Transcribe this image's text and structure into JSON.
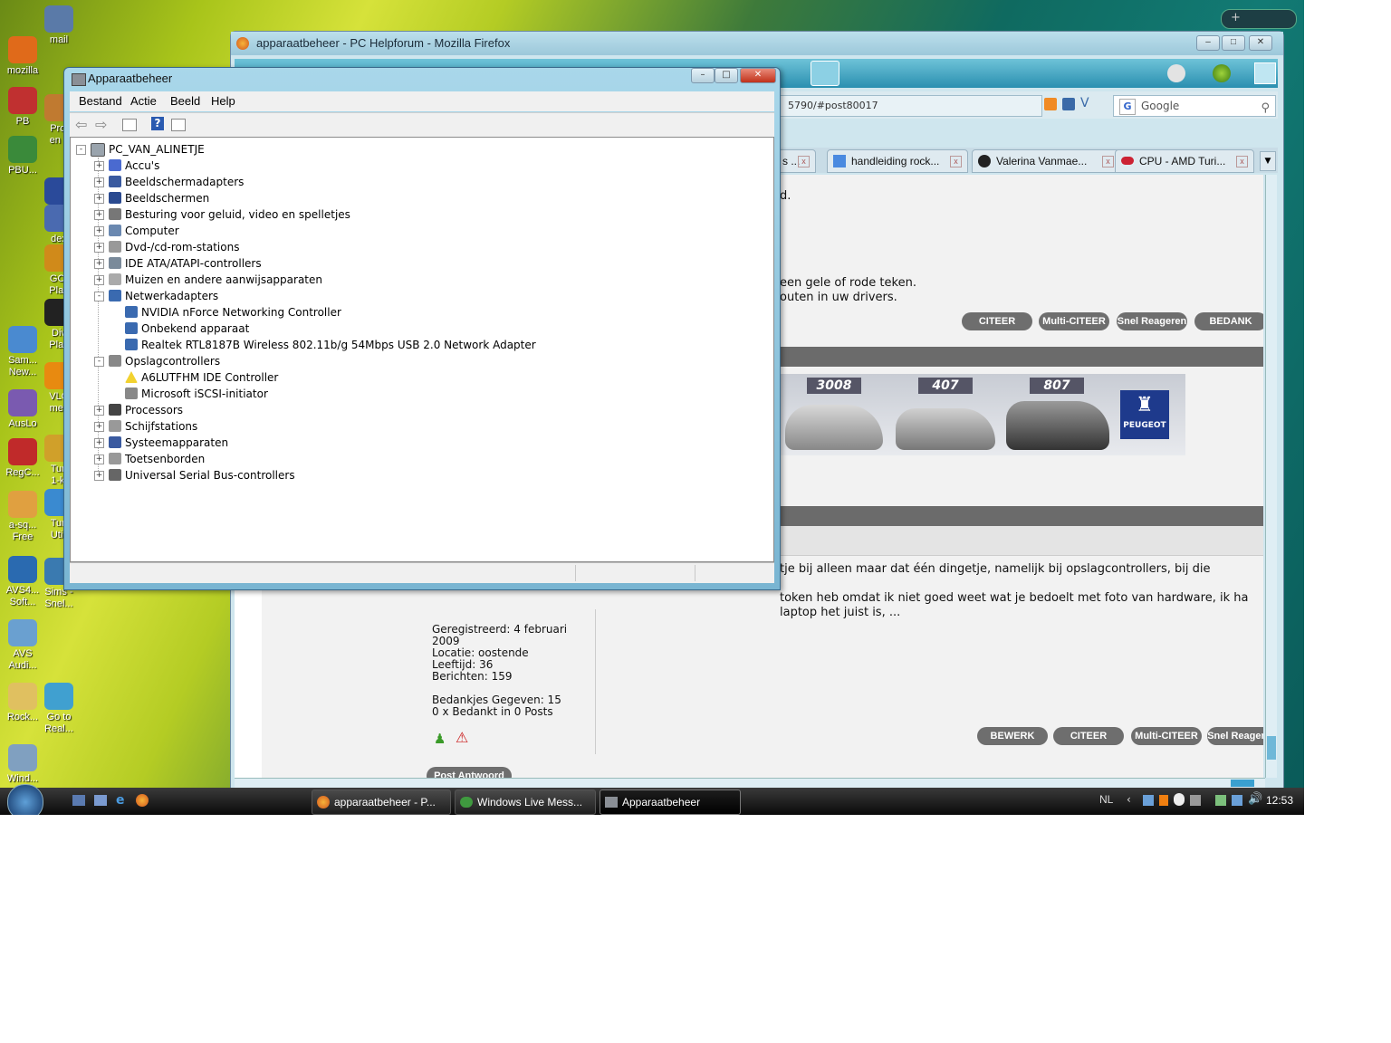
{
  "desktop": {
    "icons": [
      {
        "label": "mail"
      },
      {
        "label": "mozilla"
      },
      {
        "label": "PB"
      },
      {
        "label": "Prol\nen c"
      },
      {
        "label": "PBU..."
      },
      {
        "label": "bev"
      },
      {
        "label": "dex"
      },
      {
        "label": "GOI\nPlay"
      },
      {
        "label": "Div\nPlay"
      },
      {
        "label": "Sam...\nNew..."
      },
      {
        "label": "VLC\nmec"
      },
      {
        "label": "AusLo"
      },
      {
        "label": "RegC..."
      },
      {
        "label": "Tun\n1-kl"
      },
      {
        "label": "a-sq...\nFree"
      },
      {
        "label": "Tun\nUtili"
      },
      {
        "label": "AVS4...\nSoft..."
      },
      {
        "label": "Sims -\nSnel..."
      },
      {
        "label": "AVS\nAudi..."
      },
      {
        "label": "Rock..."
      },
      {
        "label": "Go to\nReal..."
      },
      {
        "label": "Wind..."
      }
    ]
  },
  "firefox": {
    "title": "apparaatbeheer - PC Helpforum - Mozilla Firefox",
    "url_fragment": "5790/#post80017",
    "search_placeholder": "Google",
    "tabs": [
      {
        "label": "s ..."
      },
      {
        "label": "handleiding rock..."
      },
      {
        "label": "Valerina Vanmae..."
      },
      {
        "label": "CPU - AMD Turi..."
      }
    ],
    "post1": {
      "line1": "d.",
      "line2": "een gele of rode teken.",
      "line3": "outen in uw drivers.",
      "buttons": [
        "CITEER",
        "Multi-CITEER",
        "Snel Reageren",
        "BEDANK"
      ]
    },
    "ad": {
      "models": [
        "3008",
        "407",
        "807"
      ],
      "brand": "PEUGEOT"
    },
    "post2": {
      "line1": "tje bij alleen maar dat één dingetje, namelijk bij opslagcontrollers, bij die",
      "line2": "token heb omdat ik niet goed weet wat je bedoelt met foto van hardware, ik ha",
      "line3": "laptop het juist is, ...",
      "profile": [
        "Geregistreerd: 4 februari",
        "2009",
        "Locatie: oostende",
        "Leeftijd: 36",
        "Berichten: 159",
        "",
        "Bedankjes Gegeven: 15",
        "0 x Bedankt in 0 Posts"
      ],
      "buttons": [
        "BEWERK",
        "CITEER",
        "Multi-CITEER",
        "Snel Reager"
      ]
    },
    "post_answer": "Post Antwoord"
  },
  "devmgr": {
    "title": "Apparaatbeheer",
    "menu": [
      "Bestand",
      "Actie",
      "Beeld",
      "Help"
    ],
    "root": "PC_VAN_ALINETJE",
    "nodes": [
      {
        "label": "Accu's",
        "level": 1,
        "expander": "+"
      },
      {
        "label": "Beeldschermadapters",
        "level": 1,
        "expander": "+"
      },
      {
        "label": "Beeldschermen",
        "level": 1,
        "expander": "+"
      },
      {
        "label": "Besturing voor geluid, video en spelletjes",
        "level": 1,
        "expander": "+"
      },
      {
        "label": "Computer",
        "level": 1,
        "expander": "+"
      },
      {
        "label": "Dvd-/cd-rom-stations",
        "level": 1,
        "expander": "+"
      },
      {
        "label": "IDE ATA/ATAPI-controllers",
        "level": 1,
        "expander": "+"
      },
      {
        "label": "Muizen en andere aanwijsapparaten",
        "level": 1,
        "expander": "+"
      },
      {
        "label": "Netwerkadapters",
        "level": 1,
        "expander": "-"
      },
      {
        "label": "NVIDIA nForce Networking Controller",
        "level": 2,
        "expander": ""
      },
      {
        "label": "Onbekend apparaat",
        "level": 2,
        "expander": ""
      },
      {
        "label": "Realtek RTL8187B Wireless 802.11b/g 54Mbps USB 2.0 Network Adapter",
        "level": 2,
        "expander": ""
      },
      {
        "label": "Opslagcontrollers",
        "level": 1,
        "expander": "-"
      },
      {
        "label": "A6LUTFHM IDE Controller",
        "level": 2,
        "expander": "",
        "warning": true
      },
      {
        "label": "Microsoft iSCSI-initiator",
        "level": 2,
        "expander": ""
      },
      {
        "label": "Processors",
        "level": 1,
        "expander": "+"
      },
      {
        "label": "Schijfstations",
        "level": 1,
        "expander": "+"
      },
      {
        "label": "Systeemapparaten",
        "level": 1,
        "expander": "+"
      },
      {
        "label": "Toetsenborden",
        "level": 1,
        "expander": "+"
      },
      {
        "label": "Universal Serial Bus-controllers",
        "level": 1,
        "expander": "+"
      }
    ]
  },
  "taskbar": {
    "buttons": [
      {
        "label": "apparaatbeheer - P..."
      },
      {
        "label": "Windows Live Mess..."
      },
      {
        "label": "Apparaatbeheer"
      }
    ],
    "language": "NL",
    "clock": "12:53"
  }
}
